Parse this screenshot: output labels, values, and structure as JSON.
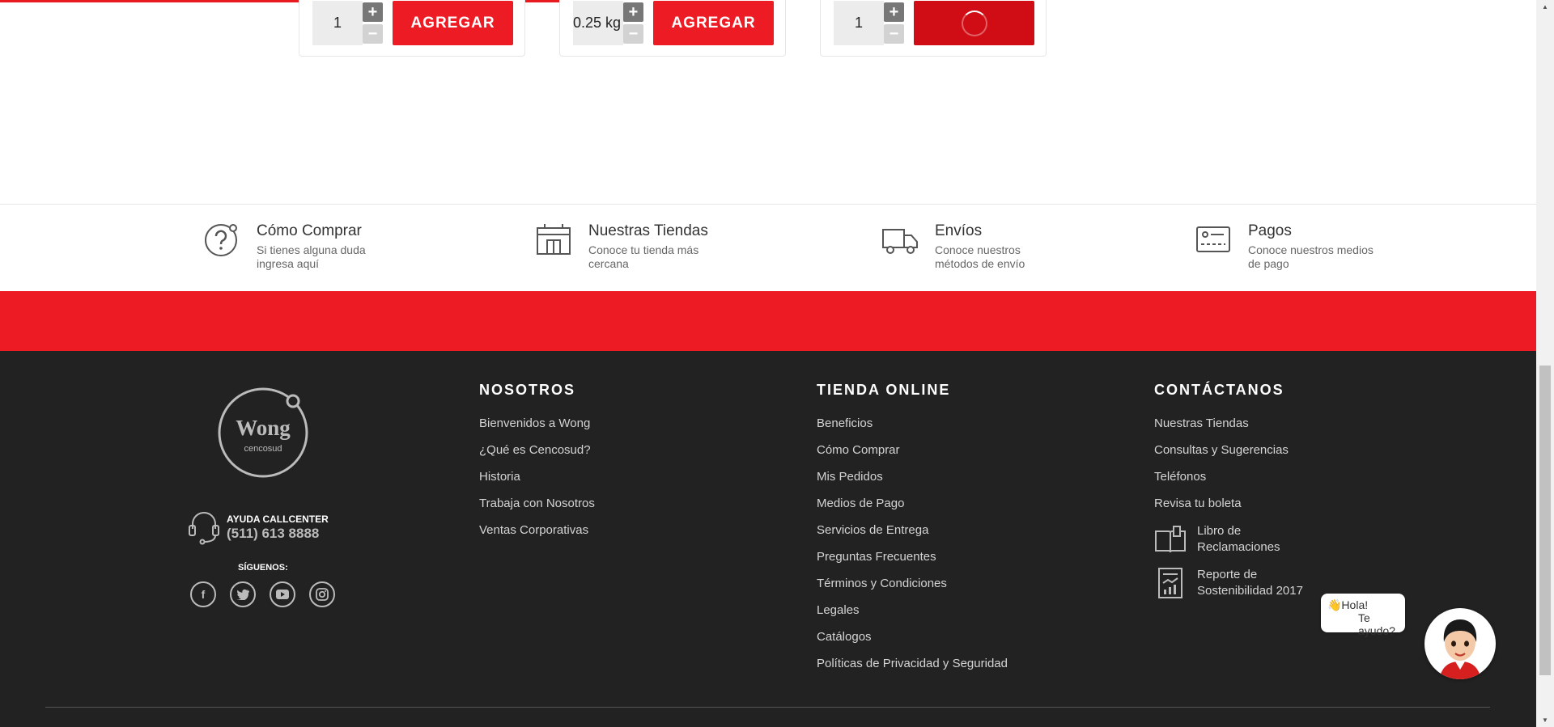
{
  "products": [
    {
      "qty": "1",
      "add_label": "AGREGAR",
      "state": "idle"
    },
    {
      "qty": "0.25 kg",
      "add_label": "AGREGAR",
      "state": "idle"
    },
    {
      "qty": "1",
      "add_label": "",
      "state": "loading"
    }
  ],
  "info": [
    {
      "title": "Cómo Comprar",
      "subtitle": "Si tienes alguna duda ingresa aquí",
      "icon": "question-icon"
    },
    {
      "title": "Nuestras Tiendas",
      "subtitle": "Conoce tu tienda más cercana",
      "icon": "store-icon"
    },
    {
      "title": "Envíos",
      "subtitle": "Conoce nuestros métodos de envío",
      "icon": "truck-icon"
    },
    {
      "title": "Pagos",
      "subtitle": "Conoce nuestros medios de pago",
      "icon": "card-icon"
    }
  ],
  "footer": {
    "logo_text": "Wong",
    "logo_sub": "cencosud",
    "callcenter_label": "AYUDA CALLCENTER",
    "callcenter_phone": "(511) 613 8888",
    "follow_label": "SÍGUENOS:",
    "socials": [
      "facebook-icon",
      "twitter-icon",
      "youtube-icon",
      "instagram-icon"
    ],
    "columns": [
      {
        "title": "NOSOTROS",
        "links": [
          "Bienvenidos a Wong",
          "¿Qué es Cencosud?",
          "Historia",
          "Trabaja con Nosotros",
          "Ventas Corporativas"
        ]
      },
      {
        "title": "TIENDA ONLINE",
        "links": [
          "Beneficios",
          "Cómo Comprar",
          "Mis Pedidos",
          "Medios de Pago",
          "Servicios de Entrega",
          "Preguntas Frecuentes",
          "Términos y Condiciones",
          "Legales",
          "Catálogos",
          "Políticas de Privacidad y Seguridad"
        ]
      },
      {
        "title": "CONTÁCTANOS",
        "links": [
          "Nuestras Tiendas",
          "Consultas y Sugerencias",
          "Teléfonos",
          "Revisa tu boleta"
        ],
        "extras": [
          {
            "label": "Libro de Reclamaciones",
            "icon": "book-icon"
          },
          {
            "label": "Reporte de Sostenibilidad 2017",
            "icon": "report-icon"
          }
        ]
      }
    ]
  },
  "chat": {
    "greeting": "👋Hola!",
    "offer": "Te ayudo?"
  },
  "colors": {
    "accent": "#ed1c24",
    "footer_bg": "#222222"
  }
}
